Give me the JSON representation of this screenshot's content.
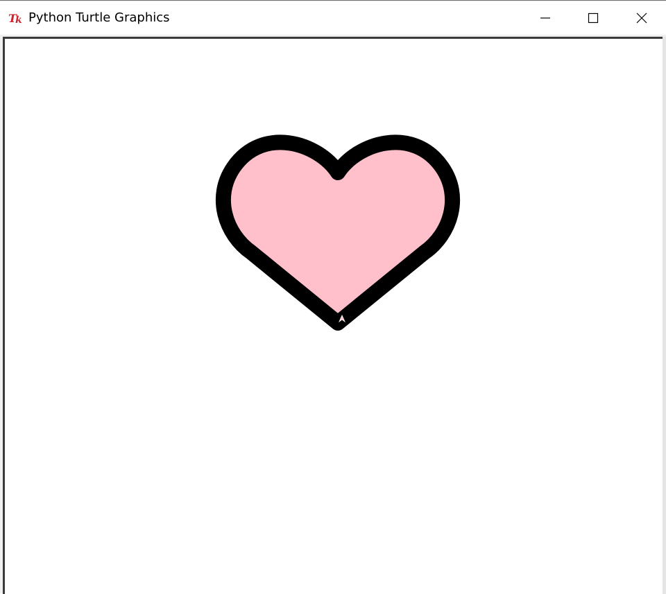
{
  "window": {
    "title": "Python Turtle Graphics",
    "icon": "tk-feather-icon",
    "controls": {
      "minimize": "minimize-icon",
      "maximize": "maximize-icon",
      "close": "close-icon"
    }
  },
  "canvas": {
    "background": "#ffffff",
    "drawing": {
      "shape": "heart",
      "fill_color": "#ffc0cb",
      "outline_color": "#000000",
      "cursor": "turtle-arrow-icon"
    }
  }
}
